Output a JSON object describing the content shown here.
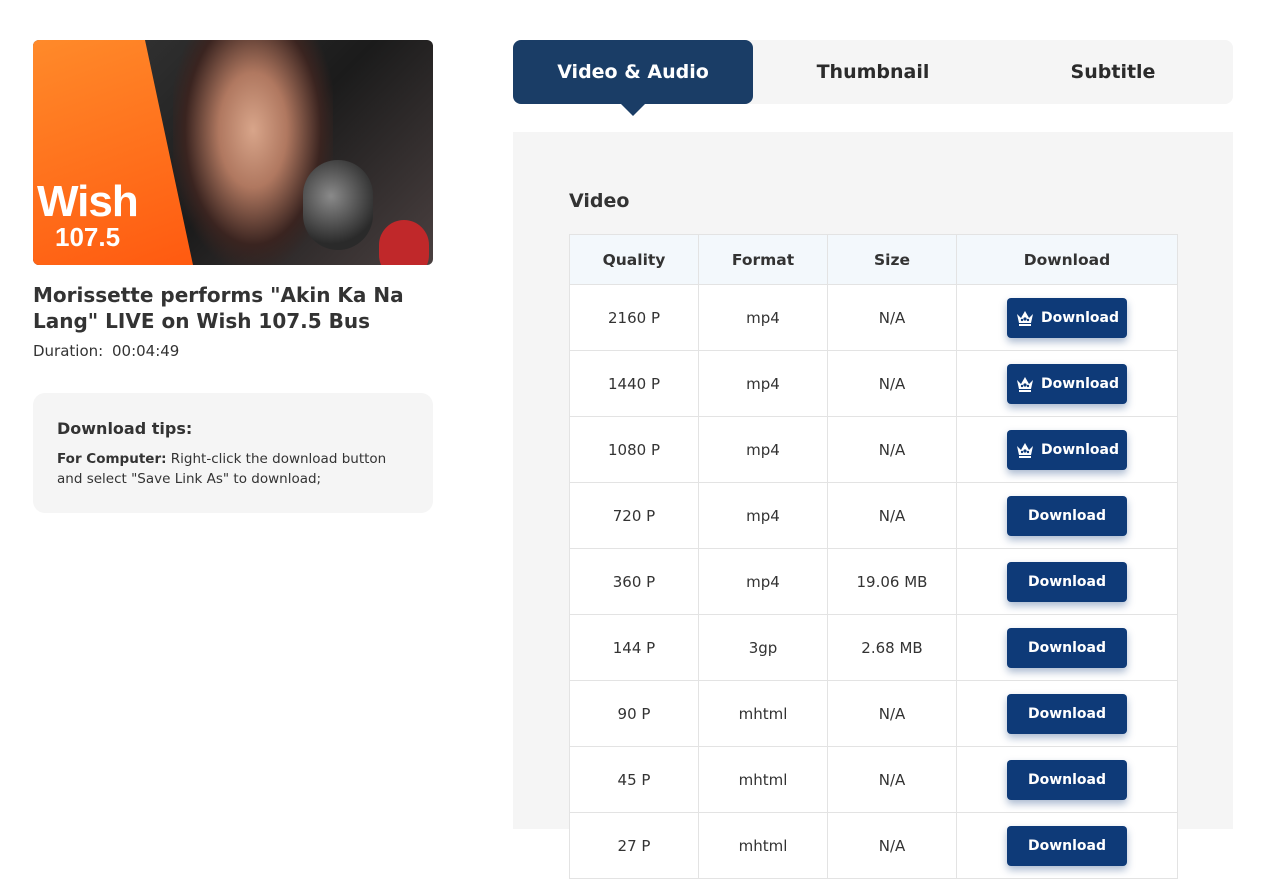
{
  "video": {
    "title": "Morissette performs \"Akin Ka Na Lang\" LIVE on Wish 107.5 Bus",
    "duration_label": "Duration:",
    "duration_value": "00:04:49",
    "thumbnail_logo_line1": "Wish",
    "thumbnail_logo_line2": "107.5"
  },
  "tips": {
    "title": "Download tips:",
    "label": "For Computer:",
    "text": "Right-click the download button and select \"Save Link As\" to download;"
  },
  "tabs": [
    {
      "label": "Video & Audio",
      "active": true
    },
    {
      "label": "Thumbnail",
      "active": false
    },
    {
      "label": "Subtitle",
      "active": false
    }
  ],
  "section_title": "Video",
  "table": {
    "headers": [
      "Quality",
      "Format",
      "Size",
      "Download"
    ],
    "rows": [
      {
        "quality": "2160 P",
        "format": "mp4",
        "size": "N/A",
        "button": "Download",
        "premium": true
      },
      {
        "quality": "1440 P",
        "format": "mp4",
        "size": "N/A",
        "button": "Download",
        "premium": true
      },
      {
        "quality": "1080 P",
        "format": "mp4",
        "size": "N/A",
        "button": "Download",
        "premium": true
      },
      {
        "quality": "720 P",
        "format": "mp4",
        "size": "N/A",
        "button": "Download",
        "premium": false
      },
      {
        "quality": "360 P",
        "format": "mp4",
        "size": "19.06 MB",
        "button": "Download",
        "premium": false
      },
      {
        "quality": "144 P",
        "format": "3gp",
        "size": "2.68 MB",
        "button": "Download",
        "premium": false
      },
      {
        "quality": "90 P",
        "format": "mhtml",
        "size": "N/A",
        "button": "Download",
        "premium": false
      },
      {
        "quality": "45 P",
        "format": "mhtml",
        "size": "N/A",
        "button": "Download",
        "premium": false
      },
      {
        "quality": "27 P",
        "format": "mhtml",
        "size": "N/A",
        "button": "Download",
        "premium": false
      }
    ]
  },
  "colors": {
    "active_tab": "#1a3d66",
    "button": "#0e3a78",
    "panel_bg": "#f5f5f5",
    "header_bg": "#f3f8fc"
  },
  "icons": {
    "premium": "crown-icon"
  }
}
